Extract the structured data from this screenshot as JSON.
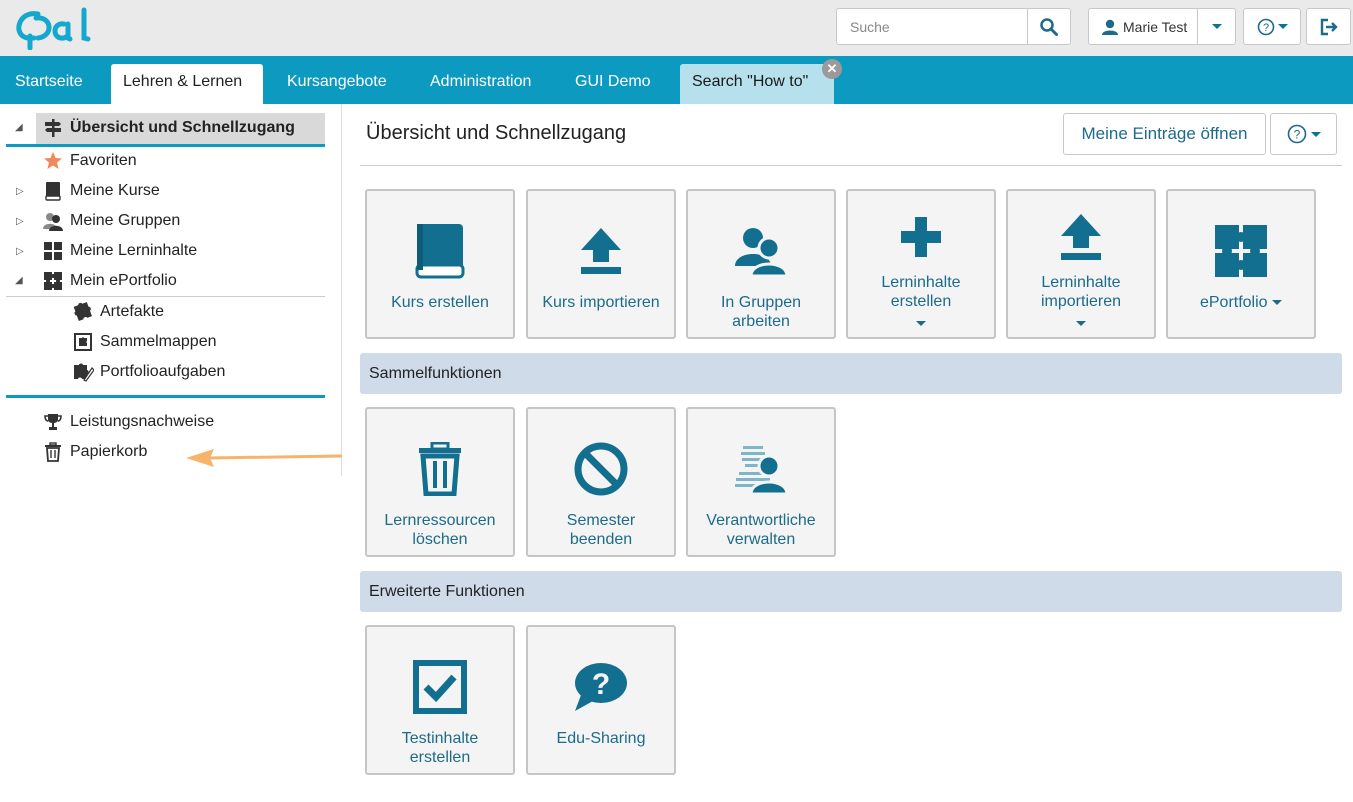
{
  "header": {
    "logo_text": "Opal",
    "search_placeholder": "Suche",
    "user_name": "Marie Test",
    "colors": {
      "accent": "#0d9ac0",
      "link": "#1c6b8a"
    }
  },
  "nav": {
    "tabs": [
      {
        "label": "Startseite"
      },
      {
        "label": "Lehren & Lernen"
      },
      {
        "label": "Kursangebote"
      },
      {
        "label": "Administration"
      },
      {
        "label": "GUI Demo"
      },
      {
        "label": "Search \"How to\""
      }
    ],
    "active_tab": "Lehren & Lernen"
  },
  "sidebar": {
    "items": [
      {
        "label": "Übersicht und Schnellzugang",
        "icon": "signpost-icon"
      },
      {
        "label": "Favoriten",
        "icon": "star-icon"
      },
      {
        "label": "Meine Kurse",
        "icon": "book-icon"
      },
      {
        "label": "Meine Gruppen",
        "icon": "group-icon"
      },
      {
        "label": "Meine Lerninhalte",
        "icon": "grid-icon"
      },
      {
        "label": "Mein ePortfolio",
        "icon": "puzzle-icon"
      },
      {
        "label": "Artefakte",
        "icon": "puzzle-piece-icon"
      },
      {
        "label": "Sammelmappen",
        "icon": "folder-puzzle-icon"
      },
      {
        "label": "Portfolioaufgaben",
        "icon": "puzzle-edit-icon"
      },
      {
        "label": "Leistungsnachweise",
        "icon": "trophy-icon"
      },
      {
        "label": "Papierkorb",
        "icon": "trash-icon"
      }
    ]
  },
  "main": {
    "title": "Übersicht und Schnellzugang",
    "open_entries_label": "Meine Einträge öffnen",
    "tiles": [
      {
        "label": "Kurs erstellen",
        "icon": "book-icon"
      },
      {
        "label": "Kurs importieren",
        "icon": "upload-icon"
      },
      {
        "label": "In Gruppen arbeiten",
        "icon": "group-icon"
      },
      {
        "label": "Lerninhalte erstellen",
        "icon": "plus-icon",
        "has_dropdown": true
      },
      {
        "label": "Lerninhalte importieren",
        "icon": "upload-icon",
        "has_dropdown": true
      },
      {
        "label": "ePortfolio",
        "icon": "puzzle-icon",
        "has_dropdown": true
      }
    ],
    "sections": [
      {
        "title": "Sammelfunktionen",
        "tiles": [
          {
            "label": "Lernressourcen löschen",
            "icon": "trash-icon"
          },
          {
            "label": "Semester beenden",
            "icon": "ban-icon"
          },
          {
            "label": "Verantwortliche verwalten",
            "icon": "group-striped-icon"
          }
        ]
      },
      {
        "title": "Erweiterte Funktionen",
        "tiles": [
          {
            "label": "Testinhalte erstellen",
            "icon": "checkbox-icon"
          },
          {
            "label": "Edu-Sharing",
            "icon": "question-bubble-icon"
          }
        ]
      }
    ]
  }
}
